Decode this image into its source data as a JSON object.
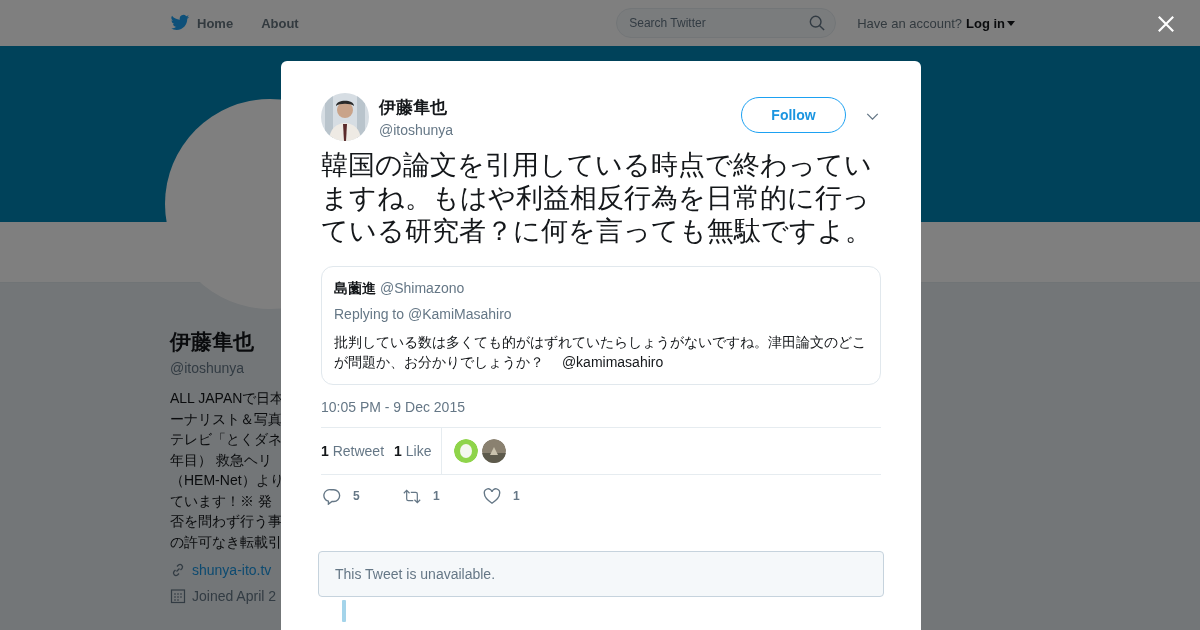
{
  "nav": {
    "items": [
      {
        "label": "Home",
        "kind": "home"
      },
      {
        "label": "About",
        "kind": "plain"
      }
    ],
    "search": {
      "placeholder": "Search Twitter"
    },
    "account_prompt": "Have an account?",
    "login": "Log in"
  },
  "profile": {
    "name": "伊藤隼也",
    "handle": "@itoshunya",
    "bio_lines": [
      "ALL JAPANで日本",
      "ーナリスト＆写真",
      "テレビ「とくダネ",
      "年目） 救急ヘリ",
      "（HEM-Net）より",
      "ています！※ 発",
      "否を問わず行う事",
      "の許可なき転載引"
    ],
    "website": "shunya-ito.tv",
    "joined": "Joined April 2"
  },
  "tweet": {
    "author": {
      "name": "伊藤隼也",
      "handle": "@itoshunya"
    },
    "follow_label": "Follow",
    "text": "韓国の論文を引用している時点で終わっていますね。もはや利益相反行為を日常的に行っている研究者？に何を言っても無駄ですよ。",
    "quoted": {
      "name": "島薗進",
      "handle": "@Shimazono",
      "replying_to": "Replying to @KamiMasahiro",
      "text": "批判している数は多くても的がはずれていたらしょうがないですね。津田論文のどこが問題か、お分かりでしょうか？",
      "mention": "@kamimasahiro"
    },
    "timestamp": "10:05 PM - 9 Dec 2015",
    "stats": [
      {
        "count": "1",
        "label": "Retweet"
      },
      {
        "count": "1",
        "label": "Like"
      }
    ],
    "actions": [
      {
        "kind": "reply",
        "count": "5"
      },
      {
        "kind": "retweet",
        "count": "1"
      },
      {
        "kind": "like",
        "count": "1"
      }
    ],
    "unavailable": "This Tweet is unavailable."
  }
}
